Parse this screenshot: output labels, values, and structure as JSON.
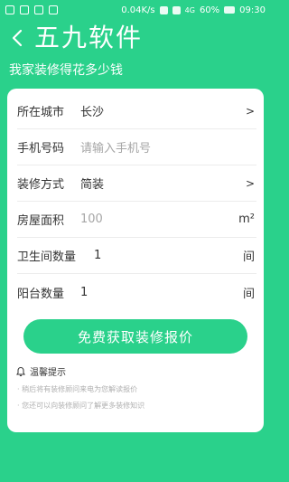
{
  "status_bar": {
    "speed": "0.04K/s",
    "network": "4G",
    "battery": "60%",
    "time": "09:30"
  },
  "app_bar": {
    "title": "五九软件"
  },
  "header": {
    "subtitle": "我家装修得花多少钱"
  },
  "form": {
    "city": {
      "label": "所在城市",
      "value": "长沙",
      "chevron": ">"
    },
    "phone": {
      "label": "手机号码",
      "placeholder": "请输入手机号"
    },
    "method": {
      "label": "装修方式",
      "value": "简装",
      "chevron": ">"
    },
    "area": {
      "label": "房屋面积",
      "placeholder": "100",
      "unit": "m²"
    },
    "bathrooms": {
      "label": "卫生间数量",
      "value": "1",
      "unit": "间"
    },
    "balconies": {
      "label": "阳台数量",
      "value": "1",
      "unit": "间"
    }
  },
  "cta": {
    "label": "免费获取装修报价"
  },
  "tips": {
    "title": "温馨提示",
    "items": [
      "稍后将有装修顾问来电为您解读报价",
      "您还可以向装修顾问了解更多装修知识"
    ]
  },
  "colors": {
    "brand": "#2ad18b",
    "card": "#ffffff",
    "placeholder": "#a6a6a6"
  }
}
